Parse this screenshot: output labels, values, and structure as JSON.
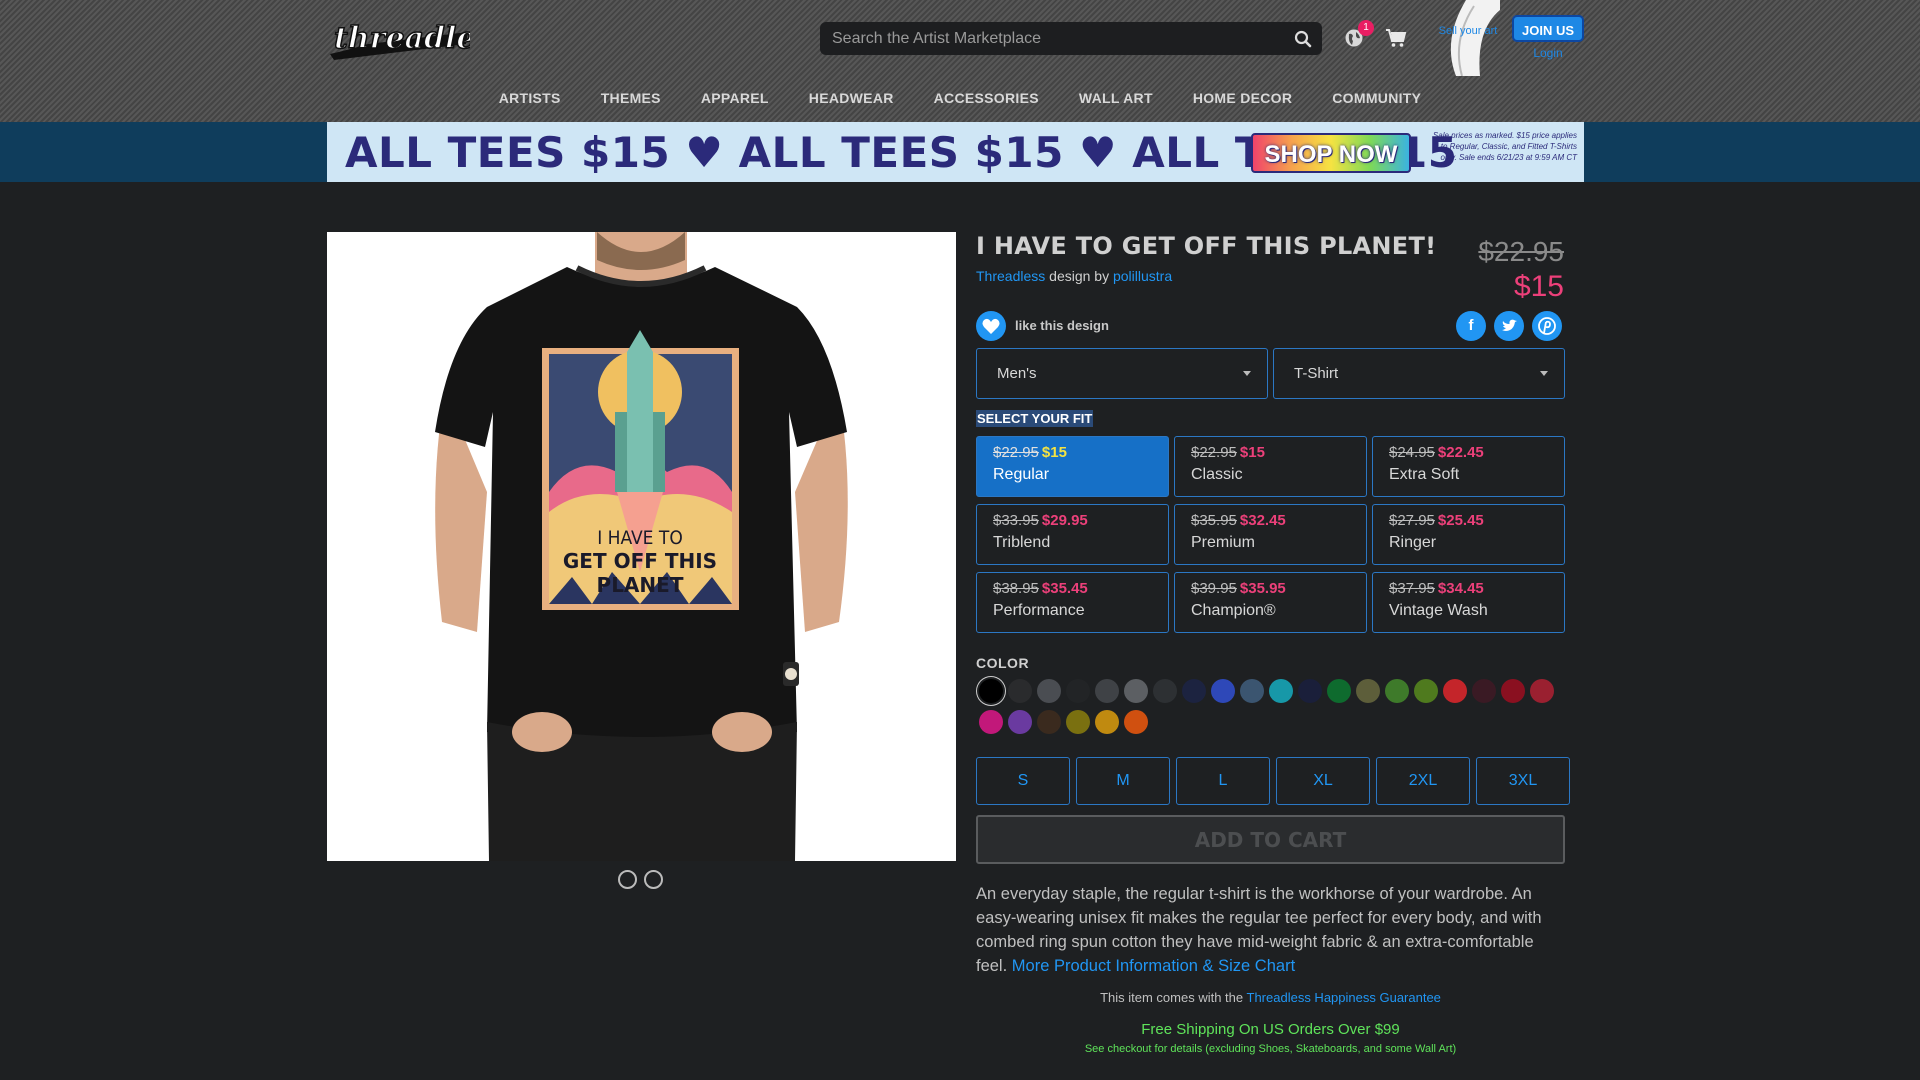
{
  "header": {
    "logo_text": "threadless",
    "search_placeholder": "Search the Artist Marketplace",
    "notification_count": "1",
    "sell_label": "Sell your art",
    "join_label": "JOIN US",
    "login_label": "Login"
  },
  "nav": [
    "ARTISTS",
    "THEMES",
    "APPAREL",
    "HEADWEAR",
    "ACCESSORIES",
    "WALL ART",
    "HOME DECOR",
    "COMMUNITY"
  ],
  "banner": {
    "promo": "ALL TEES $15 ♥ ALL TEES $15 ♥ ALL TEES $15",
    "cta": "SHOP NOW",
    "note": "Sale prices as marked. $15 price applies to Regular, Classic, and Fitted T-Shirts only. Sale ends 6/21/23 at 9:59 AM CT"
  },
  "product": {
    "title": "I HAVE TO GET OFF THIS PLANET!",
    "brand": "Threadless",
    "design_by": "design by",
    "artist": "polillustra",
    "old_price": "$22.95",
    "price": "$15",
    "like_label": "like this design",
    "print_text": "I HAVE TO GET OFF THIS PLANET"
  },
  "share": {
    "facebook": "f",
    "twitter": "t",
    "pinterest": "p"
  },
  "selects": {
    "gender": "Men's",
    "style": "T-Shirt"
  },
  "fit_title": "SELECT YOUR FIT",
  "fits": [
    {
      "old": "$22.95",
      "new": "$15",
      "name": "Regular"
    },
    {
      "old": "$22.95",
      "new": "$15",
      "name": "Classic"
    },
    {
      "old": "$24.95",
      "new": "$22.45",
      "name": "Extra Soft"
    },
    {
      "old": "$33.95",
      "new": "$29.95",
      "name": "Triblend"
    },
    {
      "old": "$35.95",
      "new": "$32.45",
      "name": "Premium"
    },
    {
      "old": "$27.95",
      "new": "$25.45",
      "name": "Ringer"
    },
    {
      "old": "$38.95",
      "new": "$35.45",
      "name": "Performance"
    },
    {
      "old": "$39.95",
      "new": "$35.95",
      "name": "Champion®"
    },
    {
      "old": "$37.95",
      "new": "$34.45",
      "name": "Vintage Wash"
    }
  ],
  "selected_fit": "Regular",
  "color_title": "COLOR",
  "colors": [
    "#000000",
    "#2a2b2d",
    "#4a4d52",
    "#222426",
    "#3f4246",
    "#5c5f63",
    "#2d3033",
    "#1c2340",
    "#2e48b8",
    "#3b5570",
    "#1798a8",
    "#1a1f3a",
    "#0e6b2e",
    "#5d5e3a",
    "#3e7a2a",
    "#4f7a1e",
    "#c4252a",
    "#3a1a24",
    "#8a1020",
    "#9a2030",
    "#c2187a",
    "#6a3aa0",
    "#3a2a1e",
    "#7a7010",
    "#c08a10",
    "#d05010"
  ],
  "sizes": [
    "S",
    "M",
    "L",
    "XL",
    "2XL",
    "3XL"
  ],
  "add_to_cart": "ADD TO CART",
  "description": "An everyday staple, the regular t-shirt is the workhorse of your wardrobe. An easy-wearing unisex fit makes the regular tee perfect for every body, and with combed ring spun cotton they have mid-weight fabric & an extra-comfortable feel.",
  "more_info": "More Product Information & Size Chart",
  "guarantee_prefix": "This item comes with the",
  "guarantee_link": "Threadless Happiness Guarantee",
  "shipping": "Free Shipping On US Orders Over $99",
  "shipping_note": "See checkout for details (excluding Shoes, Skateboards, and some Wall Art)"
}
